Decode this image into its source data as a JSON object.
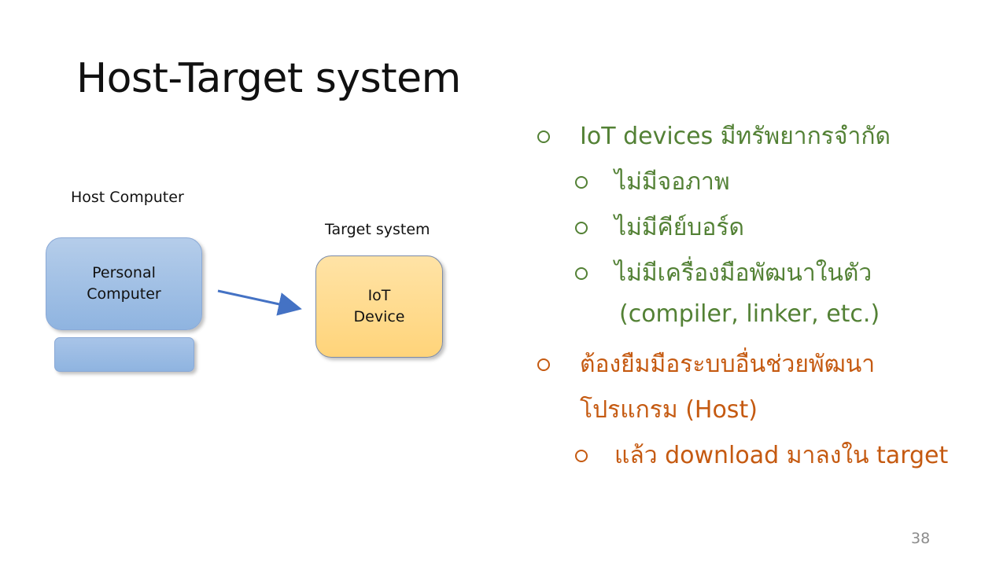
{
  "title": "Host-Target system",
  "diagram": {
    "host_label": "Host Computer",
    "target_label": "Target system",
    "pc_box": {
      "line1": "Personal",
      "line2": "Computer"
    },
    "iot_box": {
      "line1": "IoT",
      "line2": "Device"
    }
  },
  "bullets": [
    {
      "text": "IoT devices มีทรัพยากรจำกัด",
      "color": "#538135"
    },
    {
      "text": "ไม่มีจอภาพ",
      "color": "#538135"
    },
    {
      "text": "ไม่มีคีย์บอร์ด",
      "color": "#538135"
    },
    {
      "text": "ไม่มีเครื่องมือพัฒนาในตัว",
      "color": "#538135"
    },
    {
      "text": "(compiler, linker, etc.)",
      "color": "#538135"
    },
    {
      "text": "ต้องยืมมือระบบอื่นช่วยพัฒนา",
      "color": "#c55a11"
    },
    {
      "text": "โปรแกรม (Host)",
      "color": "#c55a11"
    },
    {
      "text": "แล้ว download มาลงใน target",
      "color": "#c55a11"
    }
  ],
  "page_number": "38",
  "colors": {
    "green_text": "#538135",
    "brown_text": "#c55a11",
    "pc_box": "#9dbde4",
    "iot_box": "#ffd98c",
    "arrow": "#4472c4"
  },
  "icons": {
    "arrow": "arrow-right-icon",
    "bullet": "hollow-circle-bullet-icon"
  }
}
